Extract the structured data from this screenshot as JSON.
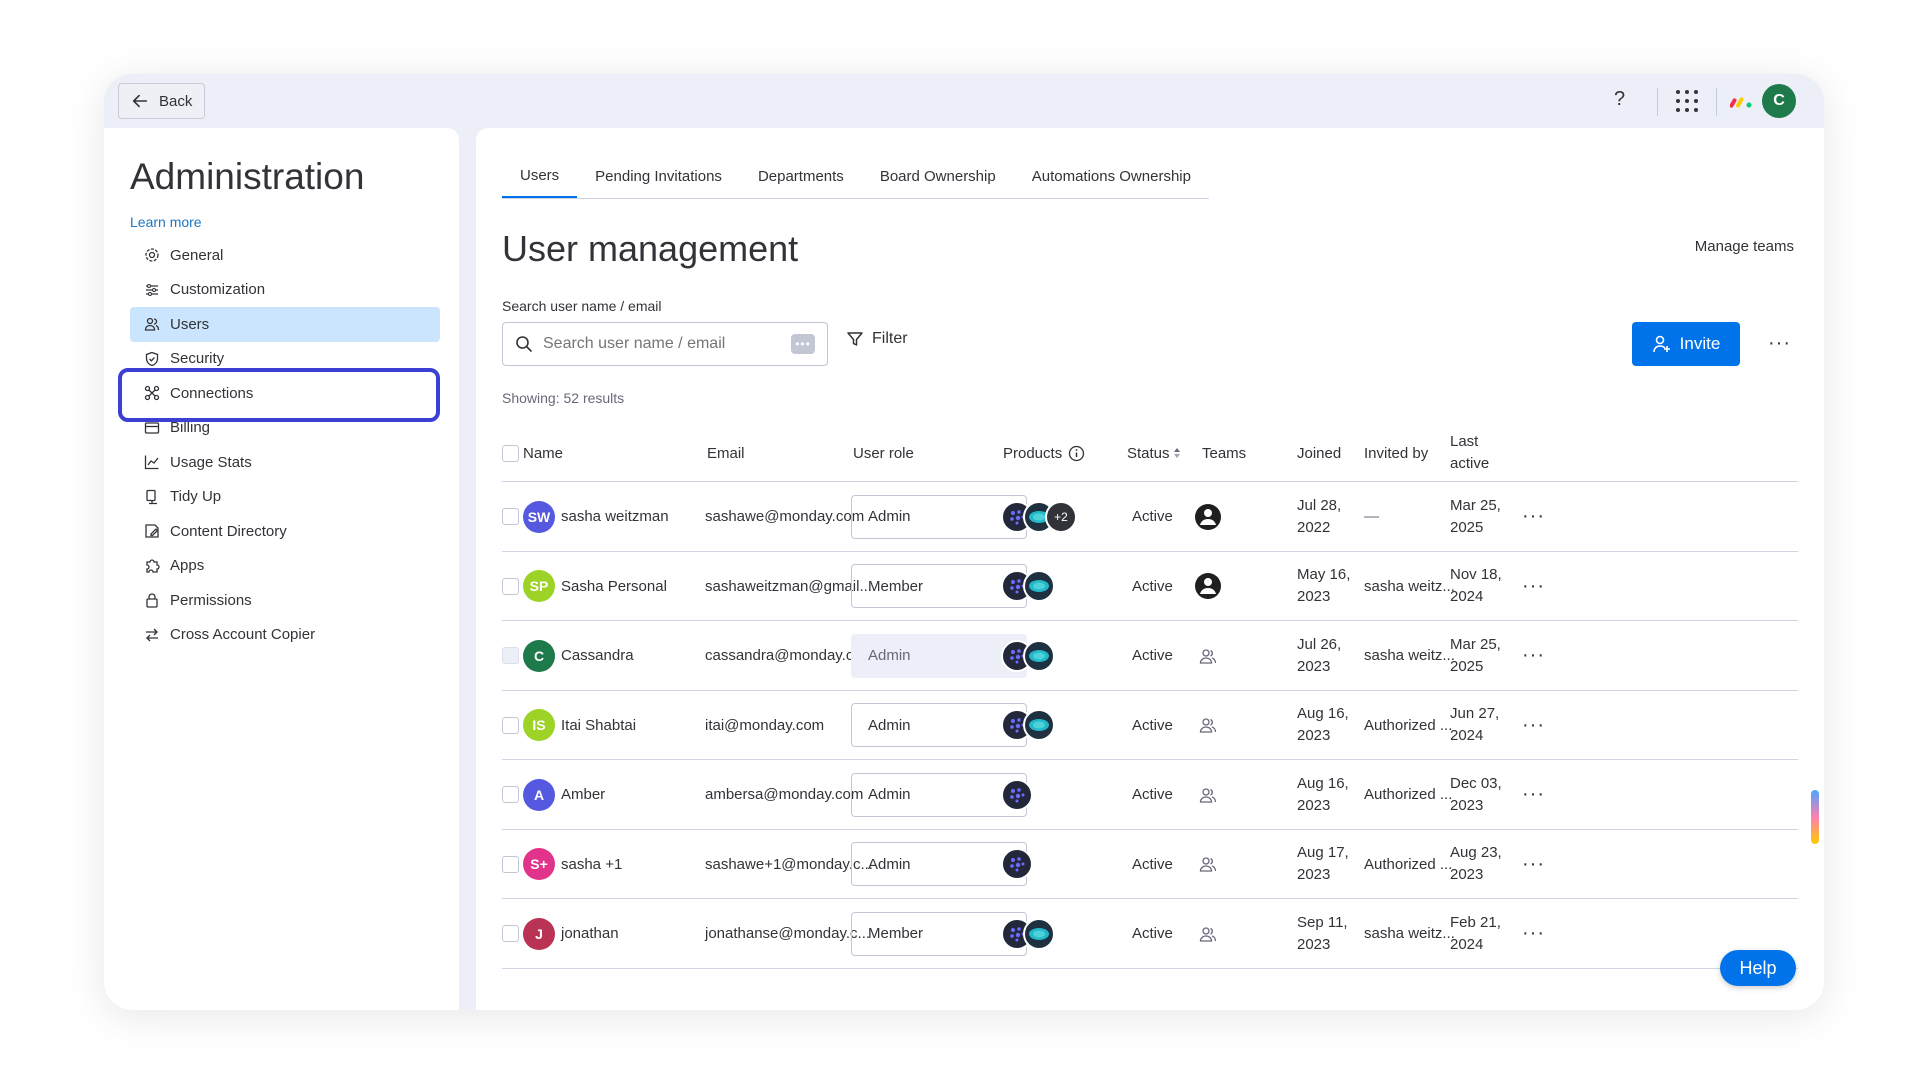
{
  "topbar": {
    "back_label": "Back",
    "help_symbol": "?"
  },
  "sidebar": {
    "title": "Administration",
    "learn_more": "Learn more",
    "items": [
      {
        "label": "General",
        "icon": "gear-icon"
      },
      {
        "label": "Customization",
        "icon": "sliders-icon"
      },
      {
        "label": "Users",
        "icon": "users-icon",
        "active": true
      },
      {
        "label": "Security",
        "icon": "shield-icon"
      },
      {
        "label": "Connections",
        "icon": "connections-icon"
      },
      {
        "label": "Billing",
        "icon": "card-icon"
      },
      {
        "label": "Usage Stats",
        "icon": "chart-icon"
      },
      {
        "label": "Tidy Up",
        "icon": "broom-icon"
      },
      {
        "label": "Content Directory",
        "icon": "directory-icon"
      },
      {
        "label": "Apps",
        "icon": "puzzle-icon"
      },
      {
        "label": "Permissions",
        "icon": "lock-icon"
      },
      {
        "label": "Cross Account Copier",
        "icon": "swap-icon"
      }
    ]
  },
  "tabs": [
    "Users",
    "Pending Invitations",
    "Departments",
    "Board Ownership",
    "Automations Ownership"
  ],
  "main": {
    "title": "User management",
    "manage_teams": "Manage teams",
    "search_label": "Search user name / email",
    "search_placeholder": "Search user name / email",
    "filter_label": "Filter",
    "invite_label": "Invite",
    "showing": "Showing: 52 results"
  },
  "table": {
    "headers": {
      "name": "Name",
      "email": "Email",
      "role": "User role",
      "products": "Products",
      "status": "Status",
      "teams": "Teams",
      "joined": "Joined",
      "invited_by": "Invited by",
      "last_active_1": "Last",
      "last_active_2": "active"
    },
    "rows": [
      {
        "initials": "SW",
        "color": "#5559df",
        "name": "sasha weitzman",
        "email": "sashawe@monday.com",
        "role": "Admin",
        "role_disabled": false,
        "products": "3+",
        "products_more": "+2",
        "status": "Active",
        "team_icon": "team-filled",
        "joined_1": "Jul 28,",
        "joined_2": "2022",
        "invited_by": "—",
        "last_1": "Mar 25,",
        "last_2": "2025"
      },
      {
        "initials": "SP",
        "color": "#9cd326",
        "name": "Sasha Personal",
        "email": "sashaweitzman@gmail....",
        "role": "Member",
        "role_disabled": false,
        "products": "2",
        "products_more": "",
        "status": "Active",
        "team_icon": "team-filled",
        "joined_1": "May 16,",
        "joined_2": "2023",
        "invited_by": "sasha weitz...",
        "last_1": "Nov 18,",
        "last_2": "2024"
      },
      {
        "initials": "C",
        "color": "#1e7a4a",
        "name": "Cassandra",
        "email": "cassandra@monday.com",
        "role": "Admin",
        "role_disabled": true,
        "products": "2",
        "products_more": "",
        "status": "Active",
        "team_icon": "team-outline",
        "joined_1": "Jul 26,",
        "joined_2": "2023",
        "invited_by": "sasha weitz...",
        "last_1": "Mar 25,",
        "last_2": "2025"
      },
      {
        "initials": "IS",
        "color": "#9cd326",
        "name": "Itai Shabtai",
        "email": "itai@monday.com",
        "role": "Admin",
        "role_disabled": false,
        "products": "2",
        "products_more": "",
        "status": "Active",
        "team_icon": "team-outline",
        "joined_1": "Aug 16,",
        "joined_2": "2023",
        "invited_by": "Authorized ...",
        "last_1": "Jun 27,",
        "last_2": "2024"
      },
      {
        "initials": "A",
        "color": "#5559df",
        "name": "Amber",
        "email": "ambersa@monday.com",
        "role": "Admin",
        "role_disabled": false,
        "products": "1",
        "products_more": "",
        "status": "Active",
        "team_icon": "team-outline",
        "joined_1": "Aug 16,",
        "joined_2": "2023",
        "invited_by": "Authorized ...",
        "last_1": "Dec 03,",
        "last_2": "2023"
      },
      {
        "initials": "S+",
        "color": "#e2338b",
        "name": "sasha +1",
        "email": "sashawe+1@monday.c...",
        "role": "Admin",
        "role_disabled": false,
        "products": "1",
        "products_more": "",
        "status": "Active",
        "team_icon": "team-outline",
        "joined_1": "Aug 17,",
        "joined_2": "2023",
        "invited_by": "Authorized ...",
        "last_1": "Aug 23,",
        "last_2": "2023"
      },
      {
        "initials": "J",
        "color": "#bb3354",
        "name": "jonathan",
        "email": "jonathanse@monday.c...",
        "role": "Member",
        "role_disabled": false,
        "products": "2",
        "products_more": "",
        "status": "Active",
        "team_icon": "team-outline",
        "joined_1": "Sep 11,",
        "joined_2": "2023",
        "invited_by": "sasha weitz...",
        "last_1": "Feb 21,",
        "last_2": "2024"
      }
    ]
  },
  "help_button": "Help",
  "colors": {
    "accent": "#0073ea",
    "highlight": "#3b3fd3",
    "active_nav": "#cce5ff"
  }
}
